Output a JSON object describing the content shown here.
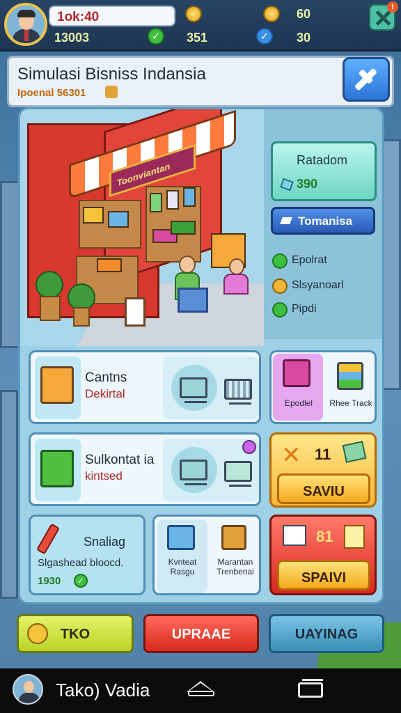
{
  "hud": {
    "player_name": "1ok:40",
    "stat_left": "13003",
    "coins_1": "",
    "stat_mid": "351",
    "coins_2": "60",
    "stat_right": "30"
  },
  "header": {
    "title": "Simulasi Bisniss Indansia",
    "subtitle": "Ipoenal 56301"
  },
  "side_panel": {
    "rating_label": "Ratadom",
    "rating_value": "390",
    "button_label": "Tomanisa",
    "stats": [
      "Epolrat",
      "Slsyanoarl",
      "Pipdi"
    ]
  },
  "shop_sign": "Toonviantan",
  "cards": [
    {
      "title": "Cantns",
      "subtitle": "Dekirtal"
    },
    {
      "title": "Sulkontat ia",
      "subtitle": "kintsed"
    },
    {
      "title": "Snaliag",
      "subtitle": "Slgashead bloocd.",
      "value": "1930"
    }
  ],
  "side_cards": [
    {
      "left_label": "Epodlel",
      "right_label": "Rhee Track"
    },
    {
      "value": "11",
      "button": "SAVIU"
    },
    {
      "value": "81",
      "button": "SPAIVI"
    }
  ],
  "small_card": {
    "left": "Kvnteat\nRasgu",
    "right": "Marantan\nTrenbenai"
  },
  "bottom_buttons": [
    "TKO",
    "UPRAAE",
    "UAYINAG"
  ],
  "nav": {
    "label": "Tako) Vadia"
  },
  "colors": {
    "accent_blue": "#2b74d6",
    "accent_orange": "#f5a91d",
    "accent_red": "#d8281e",
    "accent_lime": "#b8d424"
  }
}
